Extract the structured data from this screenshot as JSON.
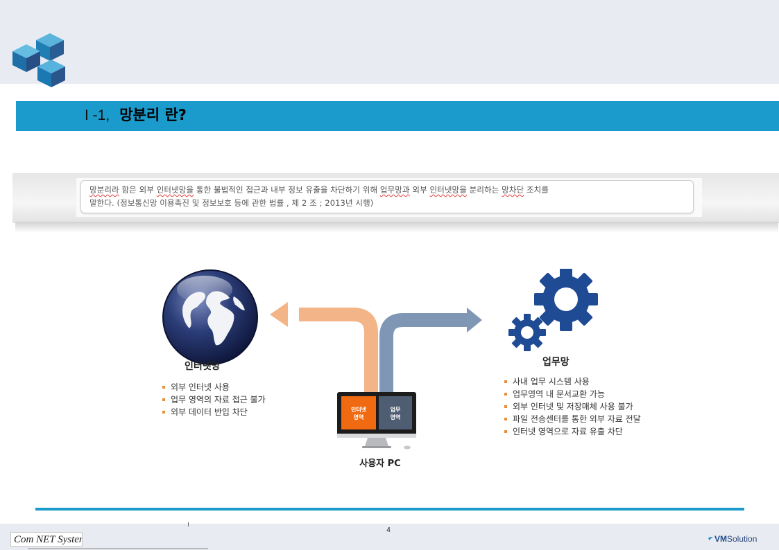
{
  "header": {
    "section_number": "I -1,",
    "title": "망분리 란?"
  },
  "definition": {
    "line1": [
      "망분리라",
      " 함은 외부 ",
      "인터넷망을",
      " 통한 불법적인 접근과 내부 정보 유출을 차단하기 위해 ",
      "업무망과",
      " 외부 ",
      "인터넷망을",
      " 분리하는 ",
      "망차단",
      " 조치를"
    ],
    "line2": "말한다. (정보통신망 이용촉진 및 정보보호 등에 관한 법률 , 제 2 조 ; 2013년 시행)"
  },
  "internet": {
    "label": "인터넷망",
    "bullets": [
      "외부 인터넷 사용",
      "업무 영역의 자료 접근 불가",
      "외부 데이터 반입 차단"
    ]
  },
  "business": {
    "label": "업무망",
    "bullets": [
      "사내 업무 시스템 사용",
      "업무영역 내 문서교환 가능",
      "외부 인터넷 및 저장매체 사용 불가",
      "파일 전송센터를 통한 외부 자료 전달",
      "인터넷 영역으로 자료 유출 차단"
    ]
  },
  "pc": {
    "label": "사용자 PC",
    "screen_left": "인터넷\n영역",
    "screen_left_line1": "인터넷",
    "screen_left_line2": "영역",
    "screen_right_line1": "업무",
    "screen_right_line2": "영역"
  },
  "footer": {
    "page_number": "4",
    "left_logo_text": "Com NET System",
    "right_logo_prefix": "VM",
    "right_logo_suffix": "Solution"
  },
  "colors": {
    "accent_blue": "#1b9bcb",
    "internet_arrow": "#f3b588",
    "business_arrow": "#7f97b4",
    "gear_blue": "#1e4b94",
    "screen_orange": "#ef6a10",
    "screen_slate": "#4f5d72"
  }
}
